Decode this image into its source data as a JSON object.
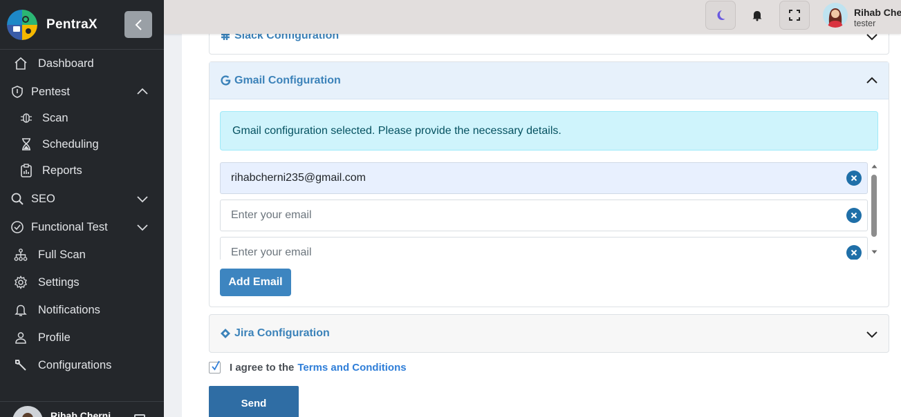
{
  "app": {
    "name": "PentraX"
  },
  "sidebar": {
    "items": [
      {
        "label": "Dashboard",
        "icon": "home-icon"
      },
      {
        "label": "Pentest",
        "icon": "shield-icon",
        "expanded": true
      },
      {
        "label": "Scan",
        "icon": "bug-icon"
      },
      {
        "label": "Scheduling",
        "icon": "hourglass-icon"
      },
      {
        "label": "Reports",
        "icon": "clipboard-icon"
      },
      {
        "label": "SEO",
        "icon": "search-icon",
        "expanded": false
      },
      {
        "label": "Functional Test",
        "icon": "check-circle-icon",
        "expanded": false
      },
      {
        "label": "Full Scan",
        "icon": "sitemap-icon"
      },
      {
        "label": "Settings",
        "icon": "gear-icon"
      },
      {
        "label": "Notifications",
        "icon": "bell-icon"
      },
      {
        "label": "Profile",
        "icon": "user-icon"
      },
      {
        "label": "Configurations",
        "icon": "wrench-icon"
      }
    ],
    "footer_user": "Rihab Cherni"
  },
  "header": {
    "user_name": "Rihab Che",
    "user_role": "tester"
  },
  "sections": {
    "slack": {
      "title": "Slack Configuration"
    },
    "gmail": {
      "title": "Gmail Configuration",
      "alert": "Gmail configuration selected. Please provide the necessary details.",
      "emails": [
        {
          "value": "rihabcherni235@gmail.com",
          "placeholder": "Enter your email"
        },
        {
          "value": "",
          "placeholder": "Enter your email"
        },
        {
          "value": "",
          "placeholder": "Enter your email"
        }
      ],
      "add_label": "Add Email"
    },
    "jira": {
      "title": "Jira Configuration"
    }
  },
  "agreement": {
    "text": "I agree to the",
    "link": "Terms and Conditions",
    "checked": true
  },
  "send_label": "Send",
  "colors": {
    "sidebar_bg": "#24272b",
    "header_bg": "#e2dedd",
    "accent": "#3b82b9",
    "send_button": "#2f6da4",
    "alert_bg": "#cff4fc"
  }
}
